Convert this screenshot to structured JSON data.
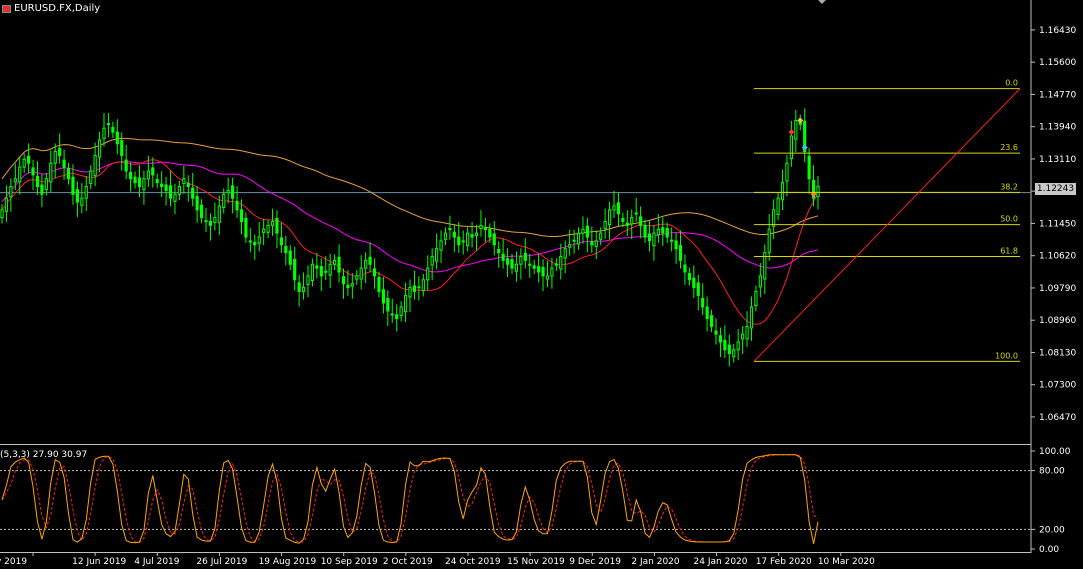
{
  "window": {
    "title": "EURUSD.FX,Daily",
    "current_price": "1.12243"
  },
  "oscillator": {
    "label": "(5,3,3) 27.90 30.97",
    "levels": [
      80,
      20
    ],
    "axis_labels": [
      "100.00",
      "80.00",
      "20.00",
      "0.00"
    ]
  },
  "fibonacci": {
    "levels": [
      {
        "label": "0.0",
        "price": 1.1492
      },
      {
        "label": "23.6",
        "price": 1.1326
      },
      {
        "label": "38.2",
        "price": 1.1225
      },
      {
        "label": "50.0",
        "price": 1.1142
      },
      {
        "label": "61.8",
        "price": 1.106
      },
      {
        "label": "100.0",
        "price": 1.079
      }
    ]
  },
  "colors": {
    "bullish": "#00ff00",
    "fib": "#d8d800",
    "ma_fast": "#ff2020",
    "ma_mid": "#ff00ff",
    "ma_slow": "#e8a040",
    "stoch_main": "#ffa500",
    "stoch_signal": "#ff2020",
    "trendline": "#ff2020"
  },
  "chart_data": {
    "type": "candlestick",
    "symbol": "EURUSD.FX",
    "timeframe": "Daily",
    "y_axis": {
      "min": 1.058,
      "max": 1.172,
      "ticks": [
        "1.16430",
        "1.15600",
        "1.14770",
        "1.13940",
        "1.13110",
        "1.12280",
        "1.11450",
        "1.10620",
        "1.09790",
        "1.08960",
        "1.08130",
        "1.07300",
        "1.06470"
      ]
    },
    "x_axis": {
      "ticks": [
        "y 2019",
        "12 Jun 2019",
        "4 Jul 2019",
        "26 Jul 2019",
        "19 Aug 2019",
        "10 Sep 2019",
        "2 Oct 2019",
        "24 Oct 2019",
        "15 Nov 2019",
        "9 Dec 2019",
        "2 Jan 2020",
        "24 Jan 2020",
        "17 Feb 2020",
        "10 Mar 2020"
      ]
    },
    "closes": [
      1.118,
      1.121,
      1.124,
      1.126,
      1.129,
      1.131,
      1.13,
      1.127,
      1.124,
      1.122,
      1.126,
      1.13,
      1.133,
      1.132,
      1.129,
      1.126,
      1.122,
      1.12,
      1.121,
      1.124,
      1.128,
      1.132,
      1.136,
      1.139,
      1.14,
      1.138,
      1.135,
      1.132,
      1.128,
      1.126,
      1.125,
      1.124,
      1.126,
      1.128,
      1.127,
      1.125,
      1.124,
      1.123,
      1.121,
      1.122,
      1.124,
      1.126,
      1.124,
      1.121,
      1.118,
      1.116,
      1.115,
      1.114,
      1.116,
      1.119,
      1.122,
      1.123,
      1.121,
      1.118,
      1.115,
      1.111,
      1.11,
      1.109,
      1.111,
      1.113,
      1.114,
      1.115,
      1.112,
      1.109,
      1.107,
      1.104,
      1.1,
      1.097,
      1.098,
      1.101,
      1.104,
      1.103,
      1.101,
      1.102,
      1.104,
      1.105,
      1.102,
      1.099,
      1.098,
      1.099,
      1.101,
      1.103,
      1.105,
      1.104,
      1.101,
      1.097,
      1.094,
      1.092,
      1.091,
      1.09,
      1.093,
      1.096,
      1.098,
      1.097,
      1.098,
      1.1,
      1.103,
      1.106,
      1.108,
      1.11,
      1.112,
      1.113,
      1.111,
      1.109,
      1.11,
      1.112,
      1.111,
      1.112,
      1.114,
      1.113,
      1.111,
      1.109,
      1.107,
      1.105,
      1.104,
      1.103,
      1.104,
      1.106,
      1.105,
      1.104,
      1.103,
      1.102,
      1.101,
      1.101,
      1.103,
      1.104,
      1.106,
      1.108,
      1.109,
      1.11,
      1.112,
      1.113,
      1.111,
      1.109,
      1.11,
      1.112,
      1.115,
      1.118,
      1.119,
      1.117,
      1.115,
      1.114,
      1.116,
      1.117,
      1.114,
      1.111,
      1.11,
      1.112,
      1.113,
      1.112,
      1.111,
      1.11,
      1.108,
      1.105,
      1.102,
      1.1,
      1.098,
      1.096,
      1.093,
      1.09,
      1.088,
      1.086,
      1.084,
      1.082,
      1.081,
      1.082,
      1.084,
      1.086,
      1.088,
      1.093,
      1.097,
      1.101,
      1.107,
      1.113,
      1.118,
      1.121,
      1.125,
      1.13,
      1.137,
      1.141,
      1.14,
      1.133,
      1.126,
      1.121,
      1.124
    ],
    "fib_anchor": {
      "low": 1.079,
      "high": 1.1492
    },
    "stochastic": {
      "main_last": 27.9,
      "signal_last": 30.97
    }
  }
}
